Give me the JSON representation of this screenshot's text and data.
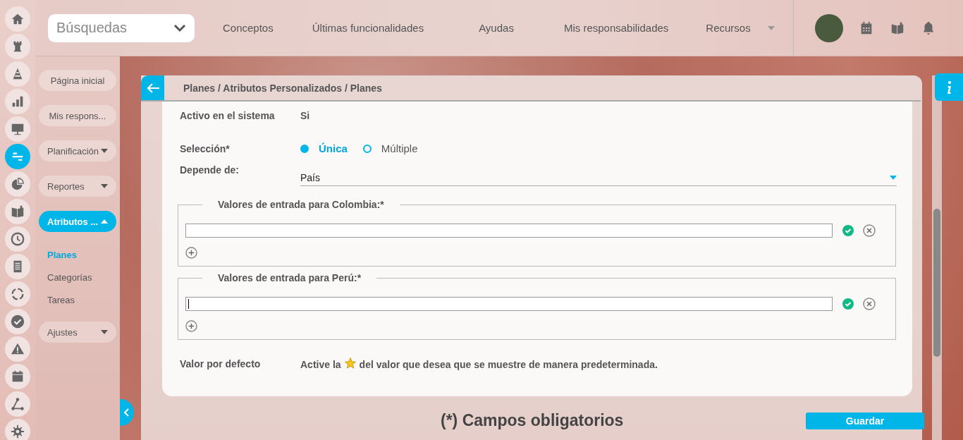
{
  "rail": [
    {
      "kind": "home",
      "selected": false
    },
    {
      "kind": "rook",
      "selected": false
    },
    {
      "kind": "cone",
      "selected": false
    },
    {
      "kind": "bars",
      "selected": false
    },
    {
      "kind": "board",
      "selected": false
    },
    {
      "kind": "lines",
      "selected": true
    },
    {
      "kind": "pie",
      "selected": false
    },
    {
      "kind": "book",
      "selected": false
    },
    {
      "kind": "clock",
      "selected": false
    },
    {
      "kind": "list",
      "selected": false
    },
    {
      "kind": "cycle",
      "selected": false
    },
    {
      "kind": "check",
      "selected": false
    },
    {
      "kind": "warning",
      "selected": false
    },
    {
      "kind": "calendar",
      "selected": false
    },
    {
      "kind": "network",
      "selected": false
    },
    {
      "kind": "gear",
      "selected": false
    }
  ],
  "search": {
    "value": "Búsquedas"
  },
  "nav": [
    {
      "label": "Conceptos",
      "has_menu": false
    },
    {
      "label": "Últimas funcionalidades",
      "has_menu": false
    },
    {
      "label": "Ayudas",
      "has_menu": false
    },
    {
      "label": "Mis responsabilidades",
      "has_menu": false
    },
    {
      "label": "Recursos",
      "has_menu": true
    }
  ],
  "sidebar": {
    "items": [
      {
        "label": "Página inicial",
        "kind": "link"
      },
      {
        "label": "Mis respons...",
        "kind": "link"
      },
      {
        "label": "Planificación",
        "kind": "menu",
        "expanded": false
      },
      {
        "label": "Reportes",
        "kind": "menu",
        "expanded": false
      },
      {
        "label": "Atributos ...",
        "kind": "menu",
        "expanded": true,
        "children": [
          {
            "label": "Planes",
            "selected": true
          },
          {
            "label": "Categorías",
            "selected": false
          },
          {
            "label": "Tareas",
            "selected": false
          }
        ]
      },
      {
        "label": "Ajustes",
        "kind": "menu",
        "expanded": false
      }
    ]
  },
  "breadcrumb": "Planes / Atributos Personalizados / Planes",
  "form": {
    "active": {
      "label": "Activo en el sistema",
      "value": "Si"
    },
    "selection": {
      "label": "Selección*",
      "options": [
        {
          "label": "Única",
          "selected": true
        },
        {
          "label": "Múltiple",
          "selected": false
        }
      ]
    },
    "depends": {
      "label": "Depende de:",
      "value": "País"
    },
    "groups": [
      {
        "legend": "Valores de entrada para Colombia:*",
        "inputs": [
          {
            "focused": false
          }
        ]
      },
      {
        "legend": "Valores de entrada para Perú:*",
        "inputs": [
          {
            "focused": true
          }
        ]
      }
    ],
    "default": {
      "label": "Valor por defecto",
      "before": "Active la",
      "after": "del valor que desea que se muestre de manera predeterminada."
    }
  },
  "required_note": "(*) Campos obligatorios",
  "save": "Guardar"
}
